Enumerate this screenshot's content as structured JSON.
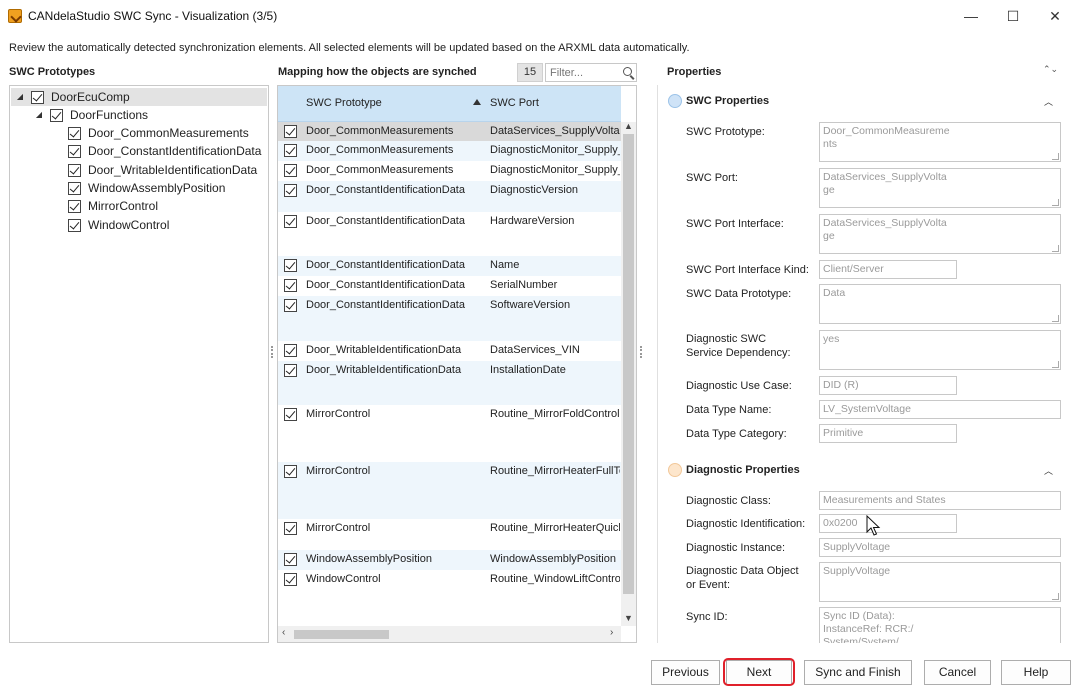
{
  "window": {
    "title": "CANdelaStudio SWC Sync - Visualization (3/5)",
    "minimize": "—",
    "maximize": "☐",
    "close": "✕"
  },
  "intro": "Review the automatically detected synchronization elements. All selected elements will be updated based on the ARXML data automatically.",
  "tree": {
    "title": "SWC Prototypes",
    "root": "DoorEcuComp",
    "group": "DoorFunctions",
    "items": [
      "Door_CommonMeasurements",
      "Door_ConstantIdentificationData",
      "Door_WritableIdentificationData",
      "WindowAssemblyPosition",
      "MirrorControl",
      "WindowControl"
    ]
  },
  "mapping": {
    "title": "Mapping how the objects are synched",
    "count": "15",
    "filter_placeholder": "Filter...",
    "col_prototype": "SWC Prototype",
    "col_port": "SWC Port",
    "rows": [
      {
        "prototype": "Door_CommonMeasurements",
        "port": "DataServices_SupplyVoltage"
      },
      {
        "prototype": "Door_CommonMeasurements",
        "port": "DiagnosticMonitor_Supply_"
      },
      {
        "prototype": "Door_CommonMeasurements",
        "port": "DiagnosticMonitor_Supply_"
      },
      {
        "prototype": "Door_ConstantIdentificationData",
        "port": "DiagnosticVersion"
      },
      {
        "prototype": "Door_ConstantIdentificationData",
        "port": "HardwareVersion"
      },
      {
        "prototype": "Door_ConstantIdentificationData",
        "port": "Name"
      },
      {
        "prototype": "Door_ConstantIdentificationData",
        "port": "SerialNumber"
      },
      {
        "prototype": "Door_ConstantIdentificationData",
        "port": "SoftwareVersion"
      },
      {
        "prototype": "Door_WritableIdentificationData",
        "port": "DataServices_VIN"
      },
      {
        "prototype": "Door_WritableIdentificationData",
        "port": "InstallationDate"
      },
      {
        "prototype": "MirrorControl",
        "port": "Routine_MirrorFoldControl"
      },
      {
        "prototype": "MirrorControl",
        "port": "Routine_MirrorHeaterFullTest"
      },
      {
        "prototype": "MirrorControl",
        "port": "Routine_MirrorHeaterQuickTest"
      },
      {
        "prototype": "WindowAssemblyPosition",
        "port": "WindowAssemblyPosition"
      },
      {
        "prototype": "WindowControl",
        "port": "Routine_WindowLiftControl"
      }
    ]
  },
  "properties": {
    "title": "Properties",
    "swc_section": "SWC Properties",
    "swc_prototype_label": "SWC Prototype:",
    "swc_prototype_value": "Door_CommonMeasureme\nnts",
    "swc_port_label": "SWC Port:",
    "swc_port_value": "DataServices_SupplyVolta\nge",
    "swc_port_interface_label": "SWC Port Interface:",
    "swc_port_interface_value": "DataServices_SupplyVolta\nge",
    "swc_port_interface_kind_label": "SWC Port Interface Kind:",
    "swc_port_interface_kind_value": "Client/Server",
    "swc_data_prototype_label": "SWC Data Prototype:",
    "swc_data_prototype_value": "Data",
    "diag_swc_dep_label": "Diagnostic SWC\nService Dependency:",
    "diag_swc_dep_value": "yes",
    "diag_use_case_label": "Diagnostic Use Case:",
    "diag_use_case_value": "DID (R)",
    "data_type_name_label": "Data Type Name:",
    "data_type_name_value": "LV_SystemVoltage",
    "data_type_category_label": "Data Type Category:",
    "data_type_category_value": "Primitive",
    "diag_section": "Diagnostic Properties",
    "diag_class_label": "Diagnostic Class:",
    "diag_class_value": "Measurements and States",
    "diag_id_label": "Diagnostic Identification:",
    "diag_id_value": "0x0200",
    "diag_instance_label": "Diagnostic Instance:",
    "diag_instance_value": "SupplyVoltage",
    "diag_data_obj_label": "Diagnostic Data Object\nor Event:",
    "diag_data_obj_value": "SupplyVoltage",
    "sync_id_label": "Sync ID:",
    "sync_id_value": "Sync ID (Data):\nInstanceRef: RCR:/\nSystem/System/"
  },
  "buttons": {
    "previous": "Previous",
    "next": "Next",
    "sync_finish": "Sync and Finish",
    "cancel": "Cancel",
    "help": "Help"
  },
  "colors": {
    "header_blue": "#cde4f6",
    "alt_row": "#eef6fc",
    "highlight_red": "#e0202a",
    "swc_dot": "#cfe3f7",
    "diag_dot": "#fde6cc"
  }
}
